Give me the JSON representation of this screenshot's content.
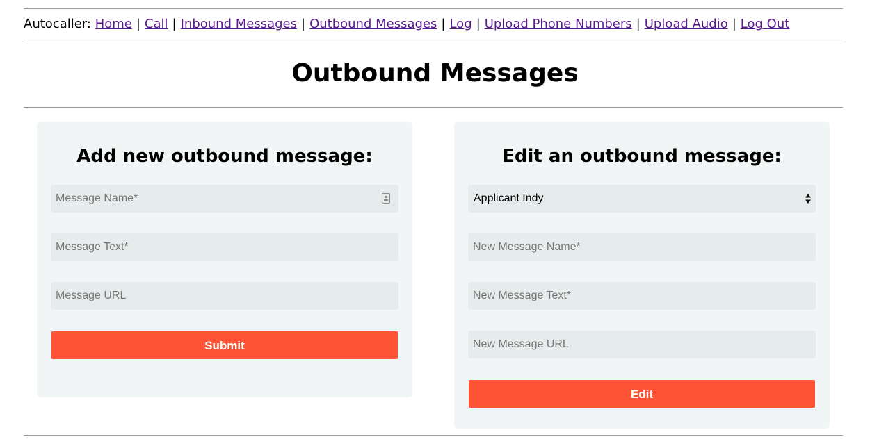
{
  "nav": {
    "brand": "Autocaller:",
    "separator": "|",
    "links": [
      "Home",
      "Call",
      "Inbound Messages",
      "Outbound Messages",
      "Log",
      "Upload Phone Numbers",
      "Upload Audio",
      "Log Out"
    ]
  },
  "page": {
    "title": "Outbound Messages"
  },
  "add_form": {
    "heading": "Add new outbound message:",
    "name_placeholder": "Message Name*",
    "text_placeholder": "Message Text*",
    "url_placeholder": "Message URL",
    "submit_label": "Submit",
    "field_icon": "contact-card-icon"
  },
  "edit_form": {
    "heading": "Edit an outbound message:",
    "selected_message": "Applicant Indy",
    "name_placeholder": "New Message Name*",
    "text_placeholder": "New Message Text*",
    "url_placeholder": "New Message URL",
    "edit_label": "Edit"
  },
  "colors": {
    "link": "#5a1a8c",
    "button": "#ff5335",
    "panel": "#f2f5f5",
    "field": "#e6ecec"
  }
}
